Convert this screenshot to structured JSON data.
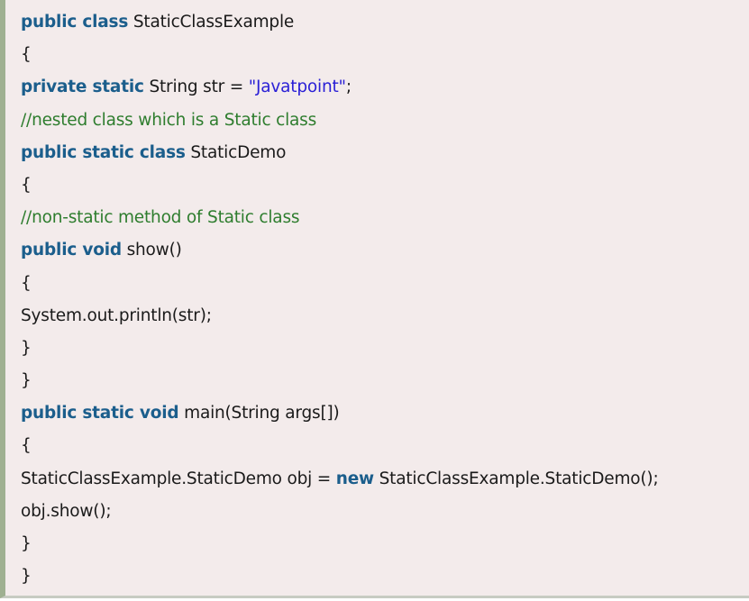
{
  "code": {
    "lines": [
      [
        {
          "t": "kw",
          "v": "public class"
        },
        {
          "t": "txt",
          "v": " StaticClassExample"
        }
      ],
      [
        {
          "t": "txt",
          "v": "{"
        }
      ],
      [
        {
          "t": "kw",
          "v": "private static"
        },
        {
          "t": "txt",
          "v": " String str = "
        },
        {
          "t": "str",
          "v": "\"Javatpoint\""
        },
        {
          "t": "txt",
          "v": ";"
        }
      ],
      [
        {
          "t": "cm",
          "v": "//nested class which is a Static class"
        }
      ],
      [
        {
          "t": "kw",
          "v": "public static class"
        },
        {
          "t": "txt",
          "v": " StaticDemo"
        }
      ],
      [
        {
          "t": "txt",
          "v": "{"
        }
      ],
      [
        {
          "t": "cm",
          "v": "//non-static method of Static class"
        }
      ],
      [
        {
          "t": "kw",
          "v": "public void"
        },
        {
          "t": "txt",
          "v": " show()"
        }
      ],
      [
        {
          "t": "txt",
          "v": "{"
        }
      ],
      [
        {
          "t": "txt",
          "v": "System.out.println(str);"
        }
      ],
      [
        {
          "t": "txt",
          "v": "}"
        }
      ],
      [
        {
          "t": "txt",
          "v": "}"
        }
      ],
      [
        {
          "t": "kw",
          "v": "public static void"
        },
        {
          "t": "txt",
          "v": " main(String args[])"
        }
      ],
      [
        {
          "t": "txt",
          "v": "{"
        }
      ],
      [
        {
          "t": "txt",
          "v": "StaticClassExample.StaticDemo obj = "
        },
        {
          "t": "kw",
          "v": "new"
        },
        {
          "t": "txt",
          "v": " StaticClassExample.StaticDemo();"
        }
      ],
      [
        {
          "t": "txt",
          "v": "obj.show();"
        }
      ],
      [
        {
          "t": "txt",
          "v": "}"
        }
      ],
      [
        {
          "t": "txt",
          "v": "}"
        }
      ]
    ]
  },
  "colors": {
    "background": "#f3ebeb",
    "left_border": "#9fb091",
    "keyword": "#1b5e8c",
    "string": "#2a1fd6",
    "comment": "#2e7d2e",
    "text": "#1a1a1a"
  }
}
